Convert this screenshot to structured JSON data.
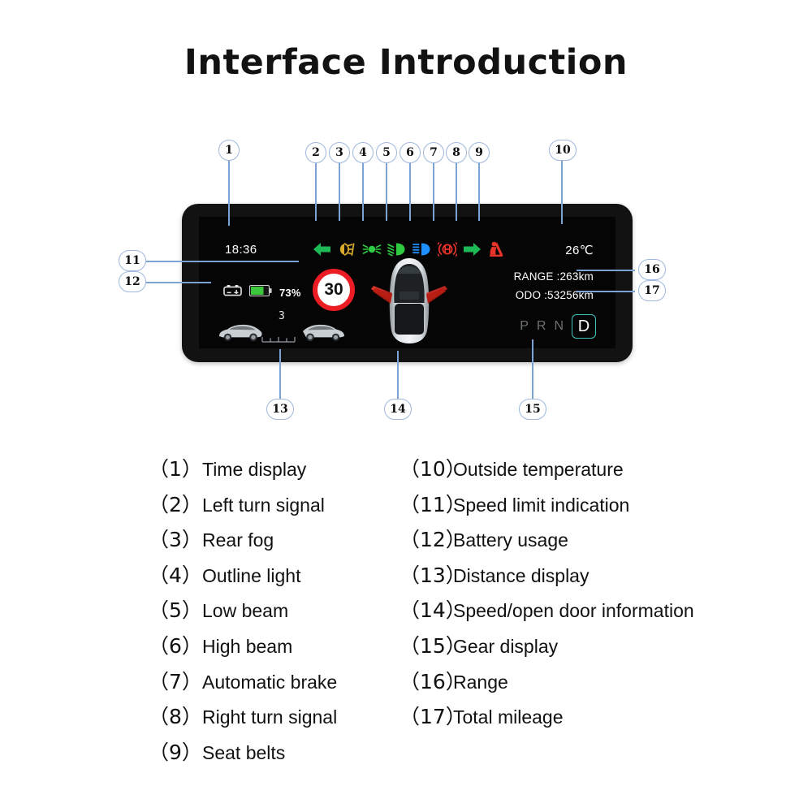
{
  "page": {
    "title": "Interface Introduction",
    "background": "#ffffff"
  },
  "colors": {
    "callout_border": "#9fb8dc",
    "leader_line": "#7da3d4",
    "bezel": "#121212",
    "screen": "#050505",
    "turn_signal_green": "#1db954",
    "rear_fog_amber": "#d8a92b",
    "outline_light_green": "#2ecc40",
    "low_beam_green": "#2ecc40",
    "high_beam_blue": "#1e90ff",
    "abs_red": "#e8342a",
    "seatbelt_red": "#e8342a",
    "speed_limit_ring": "#ec1c24",
    "gear_active": "#3fc6bd",
    "gear_inactive": "#6d7274",
    "battery_green": "#3bc93b"
  },
  "cluster": {
    "status_bar": {
      "time": "18:36",
      "temperature": "26℃"
    },
    "tell_tales": [
      {
        "id": 2,
        "name": "left-turn-signal-icon",
        "color": "#1db954"
      },
      {
        "id": 3,
        "name": "rear-fog-lamp-icon",
        "color": "#d8a92b"
      },
      {
        "id": 4,
        "name": "outline-light-icon",
        "color": "#2ecc40"
      },
      {
        "id": 5,
        "name": "low-beam-icon",
        "color": "#2ecc40"
      },
      {
        "id": 6,
        "name": "high-beam-icon",
        "color": "#1e90ff"
      },
      {
        "id": 7,
        "name": "automatic-brake-icon",
        "color": "#e8342a"
      },
      {
        "id": 8,
        "name": "right-turn-signal-icon",
        "color": "#1db954"
      },
      {
        "id": 9,
        "name": "seat-belt-icon",
        "color": "#e8342a"
      }
    ],
    "battery": {
      "percent_label": "73%",
      "percent_value": 73
    },
    "speed_limit": {
      "value": "30"
    },
    "distance": {
      "value": "3"
    },
    "range": {
      "text": "RANGE :263km",
      "value": 263,
      "unit": "km"
    },
    "odometer": {
      "text": "ODO :53256km",
      "value": 53256,
      "unit": "km"
    },
    "gear": {
      "options": [
        "P",
        "R",
        "N",
        "D"
      ],
      "selected": "D"
    }
  },
  "callouts": [
    {
      "n": "1",
      "label": "1"
    },
    {
      "n": "2",
      "label": "2"
    },
    {
      "n": "3",
      "label": "3"
    },
    {
      "n": "4",
      "label": "4"
    },
    {
      "n": "5",
      "label": "5"
    },
    {
      "n": "6",
      "label": "6"
    },
    {
      "n": "7",
      "label": "7"
    },
    {
      "n": "8",
      "label": "8"
    },
    {
      "n": "9",
      "label": "9"
    },
    {
      "n": "10",
      "label": "10"
    },
    {
      "n": "11",
      "label": "11"
    },
    {
      "n": "12",
      "label": "12"
    },
    {
      "n": "13",
      "label": "13"
    },
    {
      "n": "14",
      "label": "14"
    },
    {
      "n": "15",
      "label": "15"
    },
    {
      "n": "16",
      "label": "16"
    },
    {
      "n": "17",
      "label": "17"
    }
  ],
  "legend": {
    "left": [
      {
        "num": "（1）",
        "text": "Time display"
      },
      {
        "num": "（2）",
        "text": "Left turn signal"
      },
      {
        "num": "（3）",
        "text": "Rear fog"
      },
      {
        "num": "（4）",
        "text": "Outline light"
      },
      {
        "num": "（5）",
        "text": "Low beam"
      },
      {
        "num": "（6）",
        "text": "High beam"
      },
      {
        "num": "（7）",
        "text": "Automatic brake"
      },
      {
        "num": "（8）",
        "text": "Right turn signal"
      },
      {
        "num": "（9）",
        "text": "Seat belts"
      }
    ],
    "right": [
      {
        "num": "（10）",
        "text": "Outside temperature"
      },
      {
        "num": "（11）",
        "text": "Speed limit indication"
      },
      {
        "num": "（12）",
        "text": "Battery usage"
      },
      {
        "num": "（13）",
        "text": "Distance display"
      },
      {
        "num": "（14）",
        "text": "Speed/open door information"
      },
      {
        "num": "（15）",
        "text": "Gear display"
      },
      {
        "num": "（16）",
        "text": "Range"
      },
      {
        "num": "（17）",
        "text": "Total mileage"
      }
    ]
  }
}
